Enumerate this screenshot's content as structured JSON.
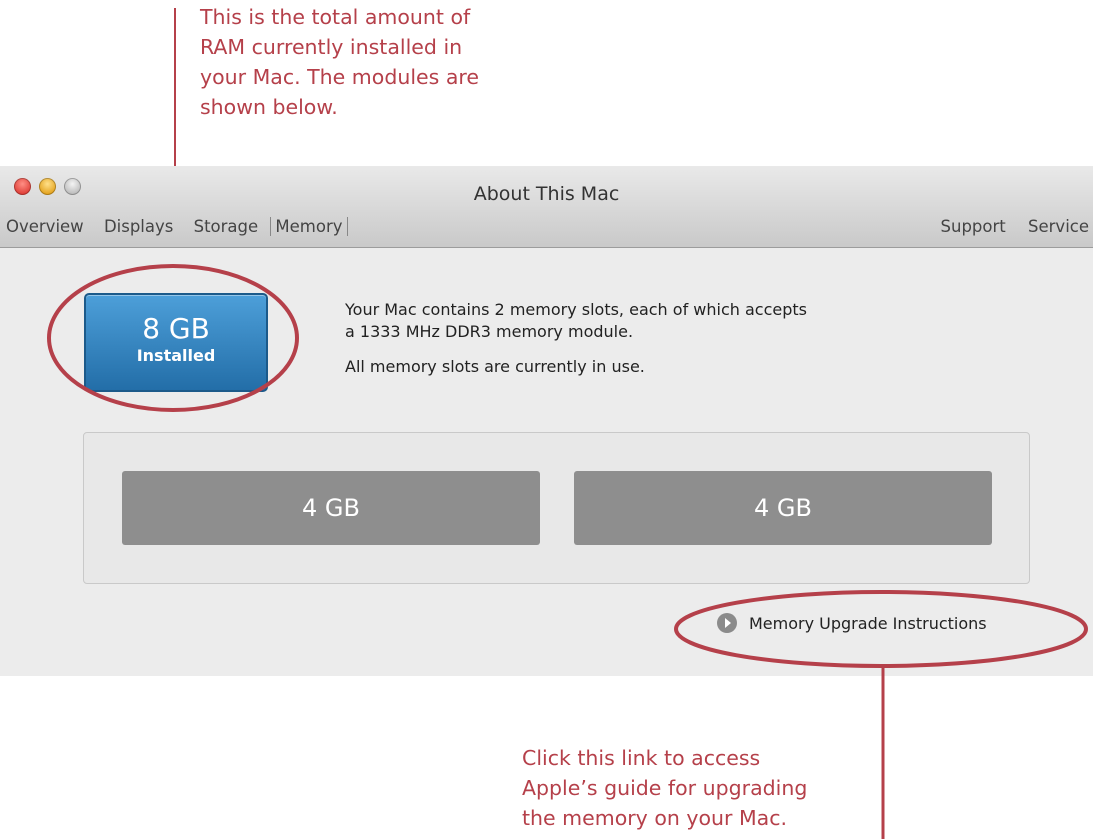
{
  "annotations": {
    "top_text": "This is the total amount of\nRAM currently installed in\nyour Mac. The modules are\nshown below.",
    "bottom_text": "Click this link to access\nApple’s guide for upgrading\nthe memory on your Mac.",
    "color": "#b5404a"
  },
  "window": {
    "title": "About This Mac",
    "tabs_left": [
      "Overview",
      "Displays",
      "Storage",
      "Memory"
    ],
    "active_tab": "Memory",
    "tabs_right": [
      "Support",
      "Service"
    ]
  },
  "memory": {
    "installed_amount": "8 GB",
    "installed_label": "Installed",
    "slots_description_line1": "Your Mac contains 2 memory slots, each of which accepts",
    "slots_description_line2": "a 1333 MHz DDR3 memory module.",
    "slots_status": "All memory slots are currently in use.",
    "modules": [
      "4 GB",
      "4 GB"
    ],
    "upgrade_link": "Memory Upgrade Instructions",
    "badge_color": "#2f7fbf"
  }
}
